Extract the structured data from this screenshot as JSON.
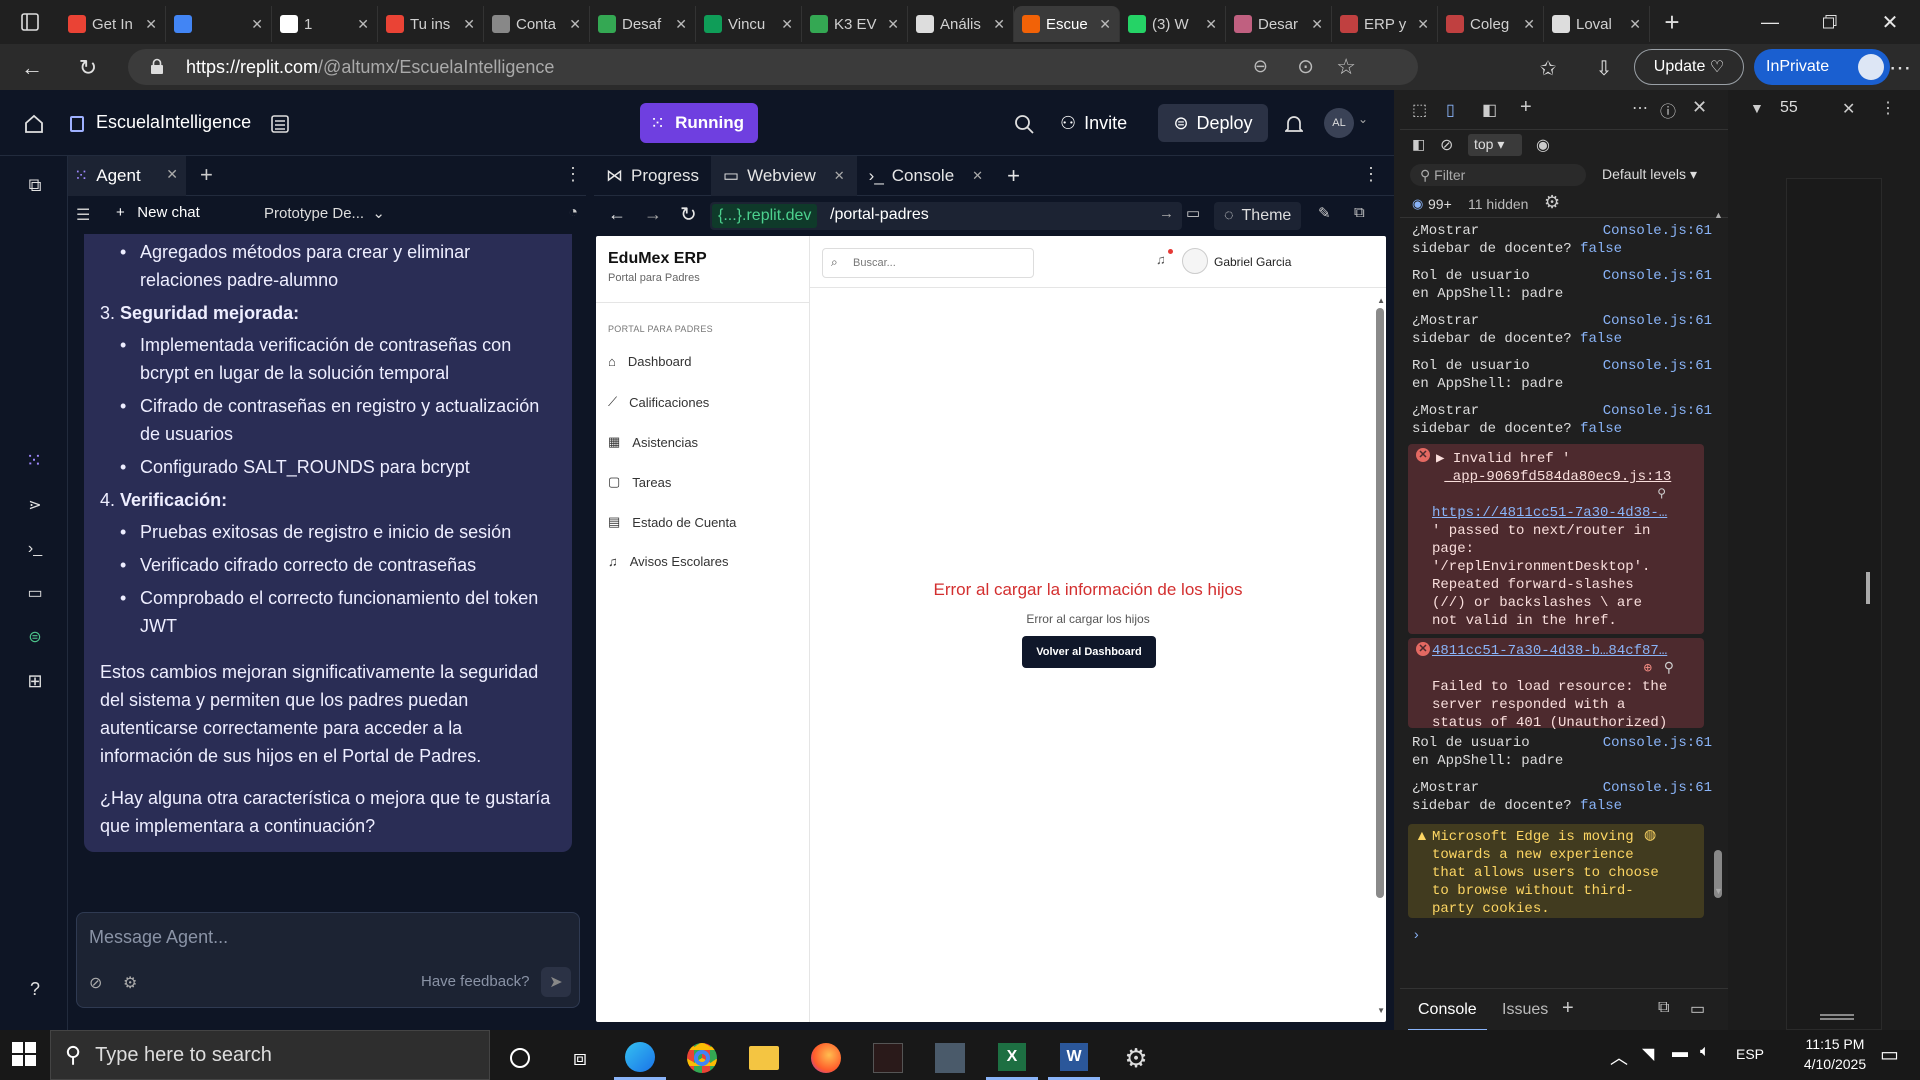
{
  "browser": {
    "tabs": [
      {
        "label": "Get In",
        "icon": "gmail-icon",
        "color": "#ea4335"
      },
      {
        "label": "",
        "icon": "docs-icon",
        "color": "#4285f4"
      },
      {
        "label": "1",
        "icon": "mail-icon",
        "color": "#ffffff"
      },
      {
        "label": "Tu ins",
        "icon": "gmail-icon",
        "color": "#ea4335"
      },
      {
        "label": "Conta",
        "icon": "page-icon",
        "color": "#888888"
      },
      {
        "label": "Desaf",
        "icon": "drive-icon",
        "color": "#34a853"
      },
      {
        "label": "Vincu",
        "icon": "sheets-icon",
        "color": "#0f9d58"
      },
      {
        "label": "K3 EV",
        "icon": "drive-icon",
        "color": "#34a853"
      },
      {
        "label": "Anális",
        "icon": "openai-icon",
        "color": "#dddddd"
      },
      {
        "label": "Escue",
        "icon": "replit-icon",
        "color": "#f26207",
        "active": true
      },
      {
        "label": "(3) W",
        "icon": "whatsapp-icon",
        "color": "#25d366"
      },
      {
        "label": "Desar",
        "icon": "tool-icon",
        "color": "#c06080"
      },
      {
        "label": "ERP y",
        "icon": "circle-icon",
        "color": "#c04040"
      },
      {
        "label": "Coleg",
        "icon": "x-icon",
        "color": "#c04040"
      },
      {
        "label": "Loval",
        "icon": "openai-icon",
        "color": "#dddddd"
      }
    ],
    "url_domain": "https://replit.com",
    "url_path": "/@altumx/EscuelaIntelligence",
    "update_label": "Update",
    "inprivate_label": "InPrivate"
  },
  "replit": {
    "project_name": "EscuelaIntelligence",
    "run_label": "Running",
    "invite_label": "Invite",
    "deploy_label": "Deploy",
    "avatar_initials": "AL",
    "agent": {
      "tab_label": "Agent",
      "new_chat_label": "New chat",
      "prototype_label": "Prototype De...",
      "bullet_top": "Agregados métodos para crear y eliminar relaciones padre-alumno",
      "sections": [
        {
          "heading_num": "3.",
          "heading": "Seguridad mejorada",
          "items": [
            "Implementada verificación de contraseñas con bcrypt en lugar de la solución temporal",
            "Cifrado de contraseñas en registro y actualización de usuarios",
            "Configurado SALT_ROUNDS para bcrypt"
          ]
        },
        {
          "heading_num": "4.",
          "heading": "Verificación",
          "items": [
            "Pruebas exitosas de registro e inicio de sesión",
            "Verificado cifrado correcto de contraseñas",
            "Comprobado el correcto funcionamiento del token JWT"
          ]
        }
      ],
      "paragraph1": "Estos cambios mejoran significativamente la seguridad del sistema y permiten que los padres puedan autenticarse correctamente para acceder a la información de sus hijos en el Portal de Padres.",
      "paragraph2": "¿Hay alguna otra característica o mejora que te gustaría que implementara a continuación?",
      "input_placeholder": "Message Agent...",
      "feedback_label": "Have feedback?"
    },
    "webview": {
      "tabs": [
        "Progress",
        "Webview",
        "Console"
      ],
      "domain_label": "{...}.replit.dev",
      "path": "/portal-padres",
      "theme_label": "Theme",
      "app": {
        "brand": "EduMex ERP",
        "subtitle": "Portal para Padres",
        "section_label": "PORTAL PARA PADRES",
        "nav": [
          "Dashboard",
          "Calificaciones",
          "Asistencias",
          "Tareas",
          "Estado de Cuenta",
          "Avisos Escolares"
        ],
        "search_placeholder": "Buscar...",
        "user_name": "Gabriel Garcia",
        "error_title": "Error al cargar la información de los hijos",
        "error_detail": "Error al cargar los hijos",
        "back_button": "Volver al Dashboard"
      }
    }
  },
  "devtools": {
    "context": "top",
    "filter_placeholder": "Filter",
    "levels": "Default levels",
    "count_label": "99+",
    "hidden_label": "11 hidden",
    "zoom_value": "55",
    "logs": [
      {
        "line1": "¿Mostrar",
        "line2": "sidebar de docente?",
        "value": "false",
        "src": "Console.js:61"
      },
      {
        "line1": "Rol de usuario",
        "line2": "en AppShell:",
        "value": "padre",
        "src": "Console.js:61"
      },
      {
        "line1": "¿Mostrar",
        "line2": "sidebar de docente?",
        "value": "false",
        "src": "Console.js:61"
      },
      {
        "line1": "Rol de usuario",
        "line2": "en AppShell:",
        "value": "padre",
        "src": "Console.js:61"
      },
      {
        "line1": "¿Mostrar",
        "line2": "sidebar de docente?",
        "value": "false",
        "src": "Console.js:61"
      }
    ],
    "error1": {
      "title": "Invalid href '",
      "src": "_app-9069fd584da80ec9.js:13",
      "link": "https://4811cc51-7a30-4d38-…",
      "body": [
        "' passed to next/router in",
        "page:",
        "'/replEnvironmentDesktop'.",
        "Repeated forward-slashes",
        "(//) or backslashes \\ are",
        "not valid in the href."
      ]
    },
    "error2": {
      "link": "4811cc51-7a30-4d38-b…84cf87…",
      "body": [
        "Failed to load resource: the",
        "server responded with a",
        "status of 401 (Unauthorized)"
      ]
    },
    "logs2": [
      {
        "line1": "Rol de usuario",
        "line2": "en AppShell:",
        "value": "padre",
        "src": "Console.js:61"
      },
      {
        "line1": "¿Mostrar",
        "line2": "sidebar de docente?",
        "value": "false",
        "src": "Console.js:61"
      }
    ],
    "warning": [
      "Microsoft Edge is moving",
      "towards a new experience",
      "that allows users to choose",
      "to browse without third-",
      "party cookies."
    ],
    "bottom_tabs": [
      "Console",
      "Issues"
    ]
  },
  "taskbar": {
    "search_placeholder": "Type here to search",
    "time": "11:15 PM",
    "date": "4/10/2025",
    "lang": "ESP"
  }
}
